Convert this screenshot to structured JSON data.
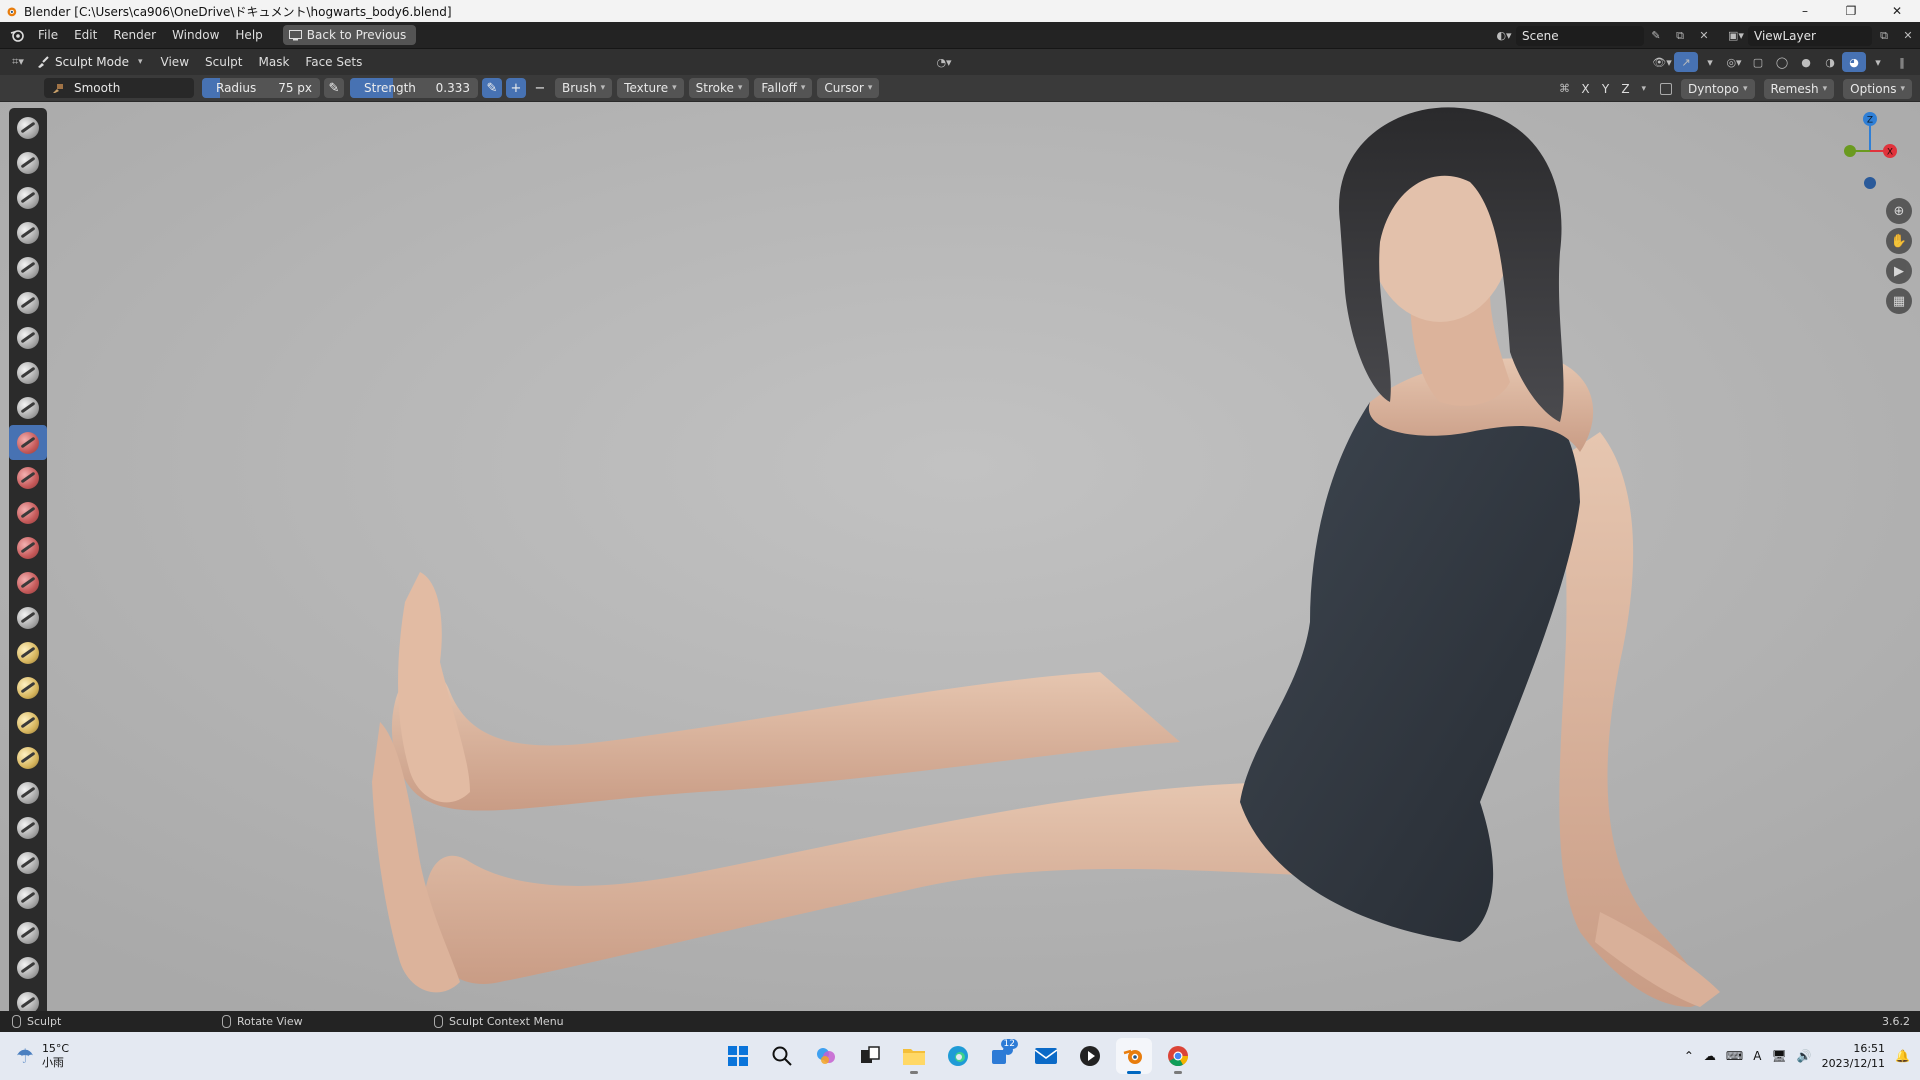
{
  "window": {
    "title": "Blender [C:\\Users\\ca906\\OneDrive\\ドキュメント\\hogwarts_body6.blend]",
    "controls": [
      "–",
      "❐",
      "✕"
    ]
  },
  "topbar": {
    "menus": [
      "File",
      "Edit",
      "Render",
      "Window",
      "Help"
    ],
    "back_button": "Back to Previous",
    "scene": "Scene",
    "view_layer": "ViewLayer"
  },
  "header": {
    "mode": "Sculpt Mode",
    "menus": [
      "View",
      "Sculpt",
      "Mask",
      "Face Sets"
    ]
  },
  "tool_settings": {
    "brush_name": "Smooth",
    "radius_label": "Radius",
    "radius_value": "75 px",
    "strength_label": "Strength",
    "strength_value": "0.333",
    "strength_fraction": 0.333,
    "menus": [
      "Brush",
      "Texture",
      "Stroke",
      "Falloff",
      "Cursor"
    ],
    "axes": [
      "X",
      "Y",
      "Z"
    ],
    "dyntopo": "Dyntopo",
    "remesh": "Remesh",
    "options": "Options"
  },
  "toolbar": {
    "tools": [
      "draw-tool",
      "draw-sharp-tool",
      "clay-tool",
      "clay-strips-tool",
      "clay-thumb-tool",
      "layer-tool",
      "inflate-tool",
      "blob-tool",
      "crease-tool",
      "smooth-tool",
      "flatten-tool",
      "fill-tool",
      "scrape-tool",
      "multiplane-scrape-tool",
      "pinch-tool",
      "grab-tool",
      "elastic-deform-tool",
      "snake-hook-tool",
      "thumb-tool",
      "pose-tool",
      "nudge-tool",
      "rotate-tool",
      "slide-relax-tool",
      "boundary-tool",
      "cloth-tool",
      "simplify-tool"
    ],
    "active_index": 9
  },
  "gizmo": {
    "z": "Z",
    "x": "X"
  },
  "statusbar": {
    "left": "Sculpt",
    "middle": "Rotate View",
    "context": "Sculpt Context Menu",
    "version": "3.6.2"
  },
  "taskbar": {
    "weather_temp": "15°C",
    "weather_desc": "小雨",
    "badge": "12",
    "time": "16:51",
    "date": "2023/12/11",
    "ime": "A"
  },
  "colors": {
    "accent": "#4772b3",
    "viewport_bg": "#b7b7b7",
    "axis_x": "#e0333c",
    "axis_y": "#6a9a1f",
    "axis_z": "#2f7fd6"
  }
}
